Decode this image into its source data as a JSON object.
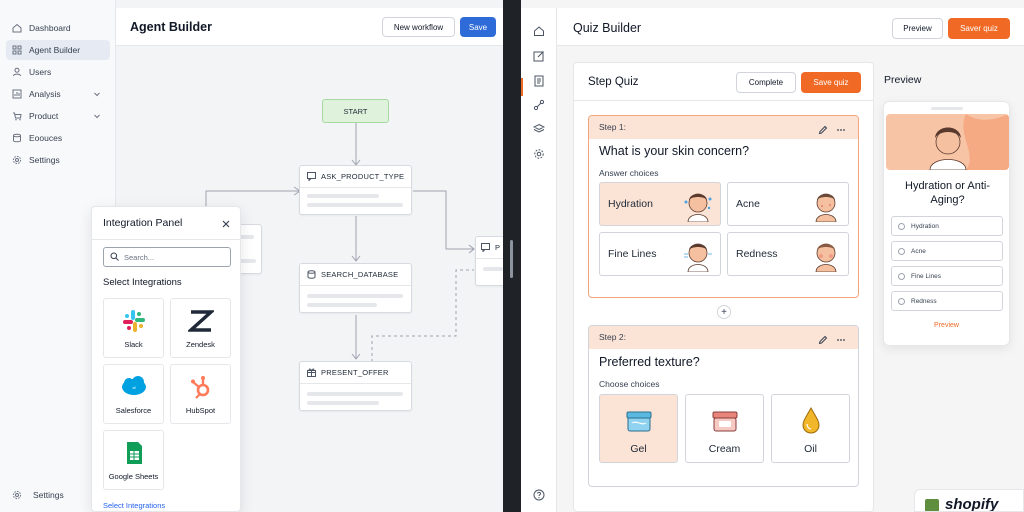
{
  "left": {
    "sidebar": {
      "items": [
        {
          "label": "Dashboard",
          "icon": "home-icon"
        },
        {
          "label": "Agent Builder",
          "icon": "grid-icon",
          "active": true
        },
        {
          "label": "Users",
          "icon": "user-icon"
        },
        {
          "label": "Analysis",
          "icon": "bar-chart-icon",
          "has_chevron": true
        },
        {
          "label": "Product",
          "icon": "cart-icon",
          "has_chevron": true
        },
        {
          "label": "Eoouces",
          "icon": "database-icon"
        },
        {
          "label": "Settings",
          "icon": "gear-icon"
        }
      ],
      "footer_label": "Settings"
    },
    "header": {
      "title": "Agent Builder",
      "new_workflow_label": "New workflow",
      "save_label": "Save"
    },
    "canvas": {
      "start_label": "START",
      "nodes": [
        {
          "label": "ASK_PRODUCT_TYPE",
          "icon": "chat-icon"
        },
        {
          "label": "SEARCH_DATABASE",
          "icon": "database-icon"
        },
        {
          "label": "PRESENT_OFFER",
          "icon": "offer-icon"
        },
        {
          "label": "P",
          "icon": "chat-icon"
        }
      ]
    },
    "integration_panel": {
      "title": "Integration Panel",
      "search_placeholder": "Search...",
      "subtitle": "Select Integrations",
      "tiles": [
        {
          "label": "Slack",
          "icon": "slack-logo"
        },
        {
          "label": "Zendesk",
          "icon": "zendesk-logo"
        },
        {
          "label": "Salesforce",
          "icon": "salesforce-logo"
        },
        {
          "label": "HubSpot",
          "icon": "hubspot-logo"
        },
        {
          "label": "Google Sheets",
          "icon": "google-sheets-logo"
        }
      ],
      "footer_link": "Select Integrations"
    }
  },
  "right": {
    "header": {
      "title": "Quiz Builder",
      "preview_label": "Preview",
      "save_label": "Saver quiz"
    },
    "editor": {
      "title": "Step Quiz",
      "complete_label": "Complete",
      "save_label": "Save quiz",
      "steps": [
        {
          "label": "Step 1:",
          "question": "What is your skin concern?",
          "subtitle": "Answer choices",
          "choices": [
            {
              "label": "Hydration",
              "selected": true
            },
            {
              "label": "Acne",
              "selected": false
            },
            {
              "label": "Fine Lines",
              "selected": false
            },
            {
              "label": "Redness",
              "selected": false
            }
          ]
        },
        {
          "label": "Step 2:",
          "question": "Preferred texture?",
          "subtitle": "Choose choices",
          "choices": [
            {
              "label": "Gel",
              "selected": true
            },
            {
              "label": "Cream",
              "selected": false
            },
            {
              "label": "Oil",
              "selected": false
            }
          ]
        }
      ],
      "add_symbol": "+"
    },
    "preview": {
      "label": "Preview",
      "question": "Hydration or Anti-Aging?",
      "options": [
        "Hydration",
        "Acne",
        "Fine Lines",
        "Redness"
      ],
      "button_label": "Preview"
    },
    "shopify_label": "shopify"
  },
  "colors": {
    "accent_orange": "#f06a25",
    "accent_blue": "#2e6bd8",
    "step_highlight": "#fbe3d6",
    "start_node": "#dff3dc"
  }
}
